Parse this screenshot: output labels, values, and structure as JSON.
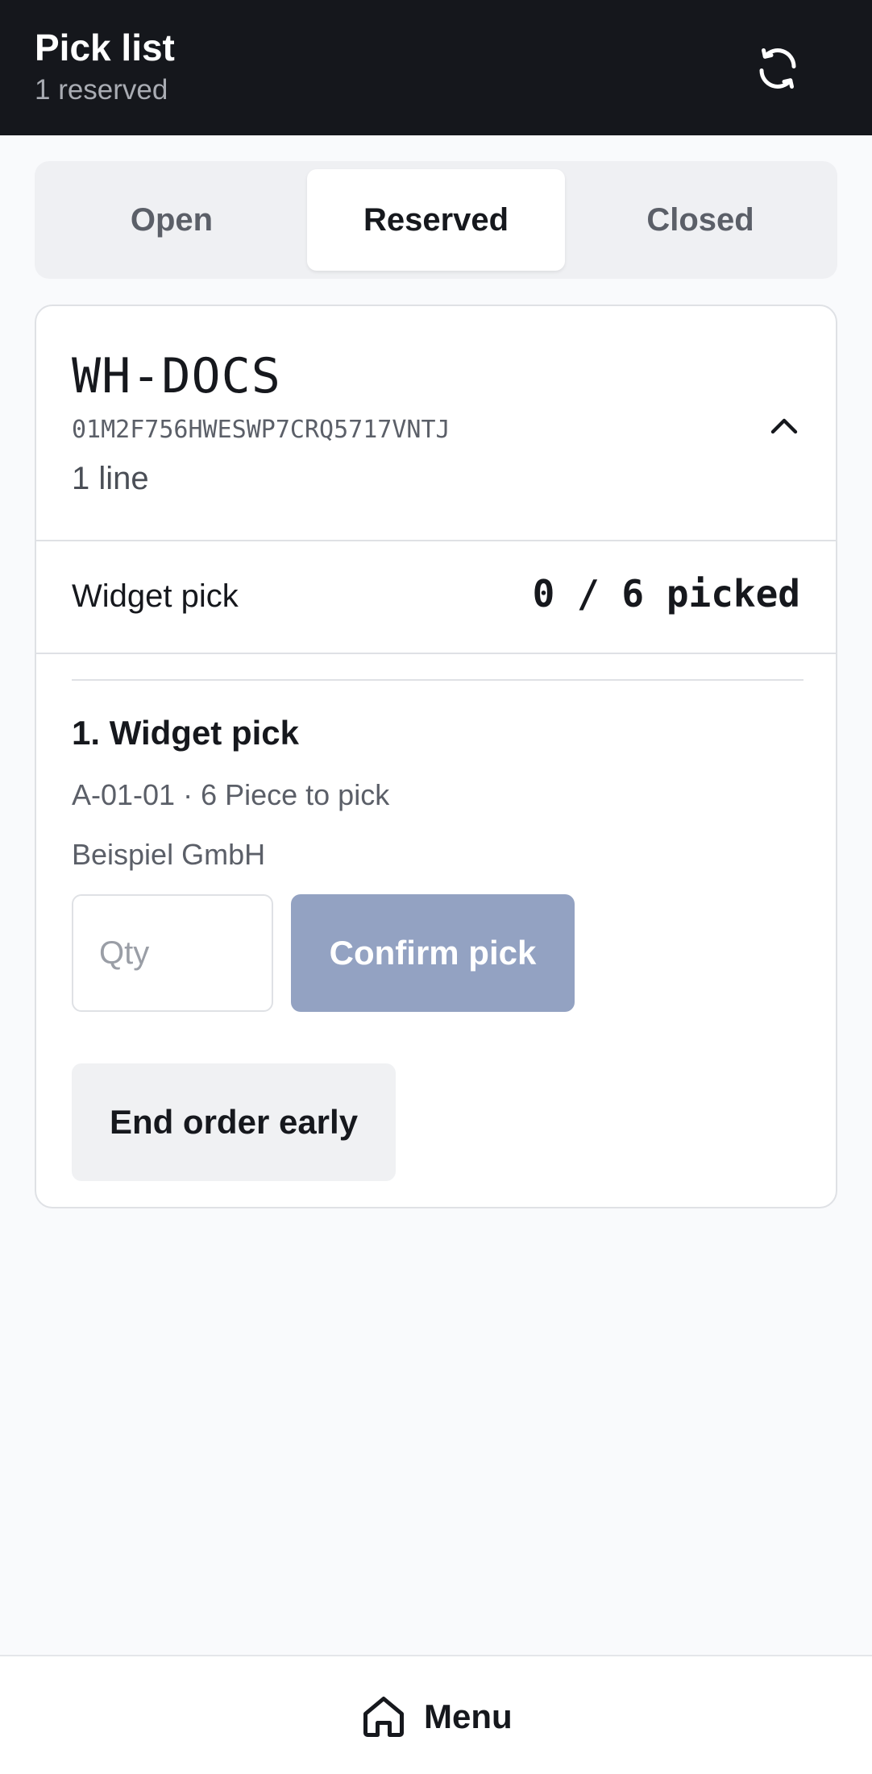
{
  "header": {
    "title": "Pick list",
    "subtitle": "1 reserved",
    "refresh_icon": "refresh-icon"
  },
  "tabs": [
    {
      "label": "Open",
      "active": false
    },
    {
      "label": "Reserved",
      "active": true
    },
    {
      "label": "Closed",
      "active": false
    }
  ],
  "order": {
    "code": "WH-DOCS",
    "id": "01M2F756HWESWP7CRQ5717VNTJ",
    "line_count": "1 line",
    "collapse_icon": "chevron-up-icon",
    "summary_label": "Widget pick",
    "summary_count": "0 / 6 picked",
    "line": {
      "title": "1. Widget pick",
      "location": "A-01-01 · 6 Piece to pick",
      "customer": "Beispiel GmbH",
      "qty_placeholder": "Qty",
      "qty_value": "",
      "confirm_label": "Confirm pick"
    },
    "end_label": "End order early"
  },
  "bottom_nav": {
    "menu_label": "Menu",
    "menu_icon": "home-icon"
  },
  "colors": {
    "header_bg": "#15171c",
    "confirm_disabled": "#93a2c2",
    "page_bg": "#f9fafc"
  }
}
